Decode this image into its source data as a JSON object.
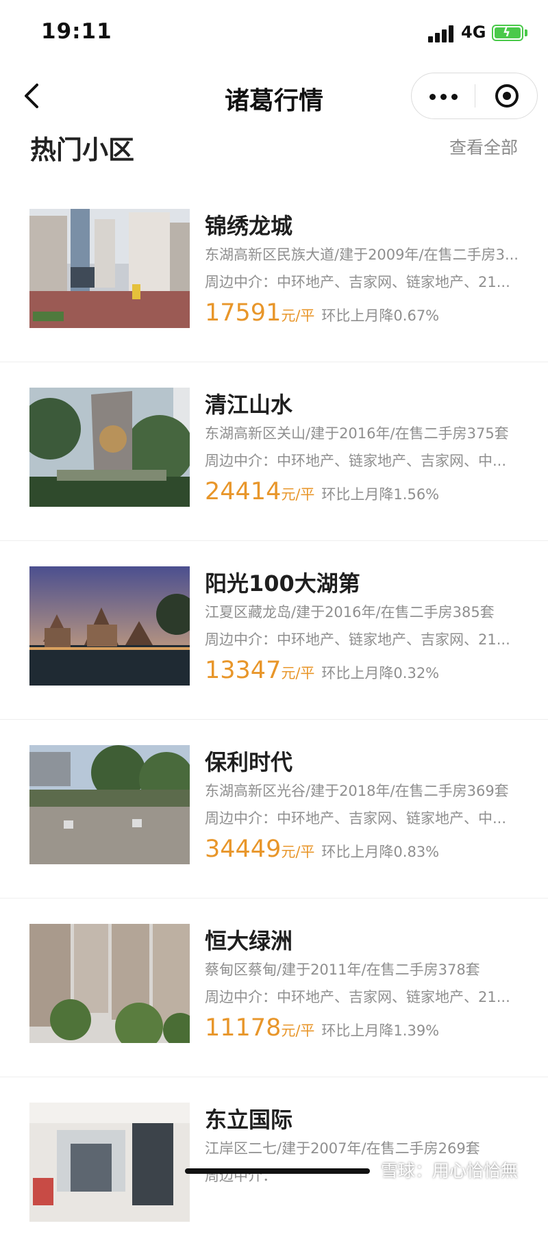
{
  "status_bar": {
    "time": "19:11",
    "network": "4G"
  },
  "nav": {
    "title": "诸葛行情"
  },
  "section": {
    "title": "热门小区",
    "view_all": "查看全部"
  },
  "communities": [
    {
      "name": "锦绣龙城",
      "detail": "东湖高新区民族大道/建于2009年/在售二手房3...",
      "agents": "周边中介：中环地产、吉家网、链家地产、21...",
      "price": "17591",
      "unit": "元/平",
      "change": "环比上月降0.67%"
    },
    {
      "name": "清江山水",
      "detail": "东湖高新区关山/建于2016年/在售二手房375套",
      "agents": "周边中介：中环地产、链家地产、吉家网、中...",
      "price": "24414",
      "unit": "元/平",
      "change": "环比上月降1.56%"
    },
    {
      "name": "阳光100大湖第",
      "detail": "江夏区藏龙岛/建于2016年/在售二手房385套",
      "agents": "周边中介：中环地产、链家地产、吉家网、21...",
      "price": "13347",
      "unit": "元/平",
      "change": "环比上月降0.32%"
    },
    {
      "name": "保利时代",
      "detail": "东湖高新区光谷/建于2018年/在售二手房369套",
      "agents": "周边中介：中环地产、吉家网、链家地产、中...",
      "price": "34449",
      "unit": "元/平",
      "change": "环比上月降0.83%"
    },
    {
      "name": "恒大绿洲",
      "detail": "蔡甸区蔡甸/建于2011年/在售二手房378套",
      "agents": "周边中介：中环地产、吉家网、链家地产、21...",
      "price": "11178",
      "unit": "元/平",
      "change": "环比上月降1.39%"
    },
    {
      "name": "东立国际",
      "detail": "江岸区二七/建于2007年/在售二手房269套",
      "agents": "周边中介：",
      "price": "",
      "unit": "",
      "change": ""
    }
  ],
  "watermark": "雪球：用心恰恰無",
  "colors": {
    "price": "#e8962a",
    "secondary_text": "#8f8f8f",
    "battery": "#4ac94a"
  }
}
